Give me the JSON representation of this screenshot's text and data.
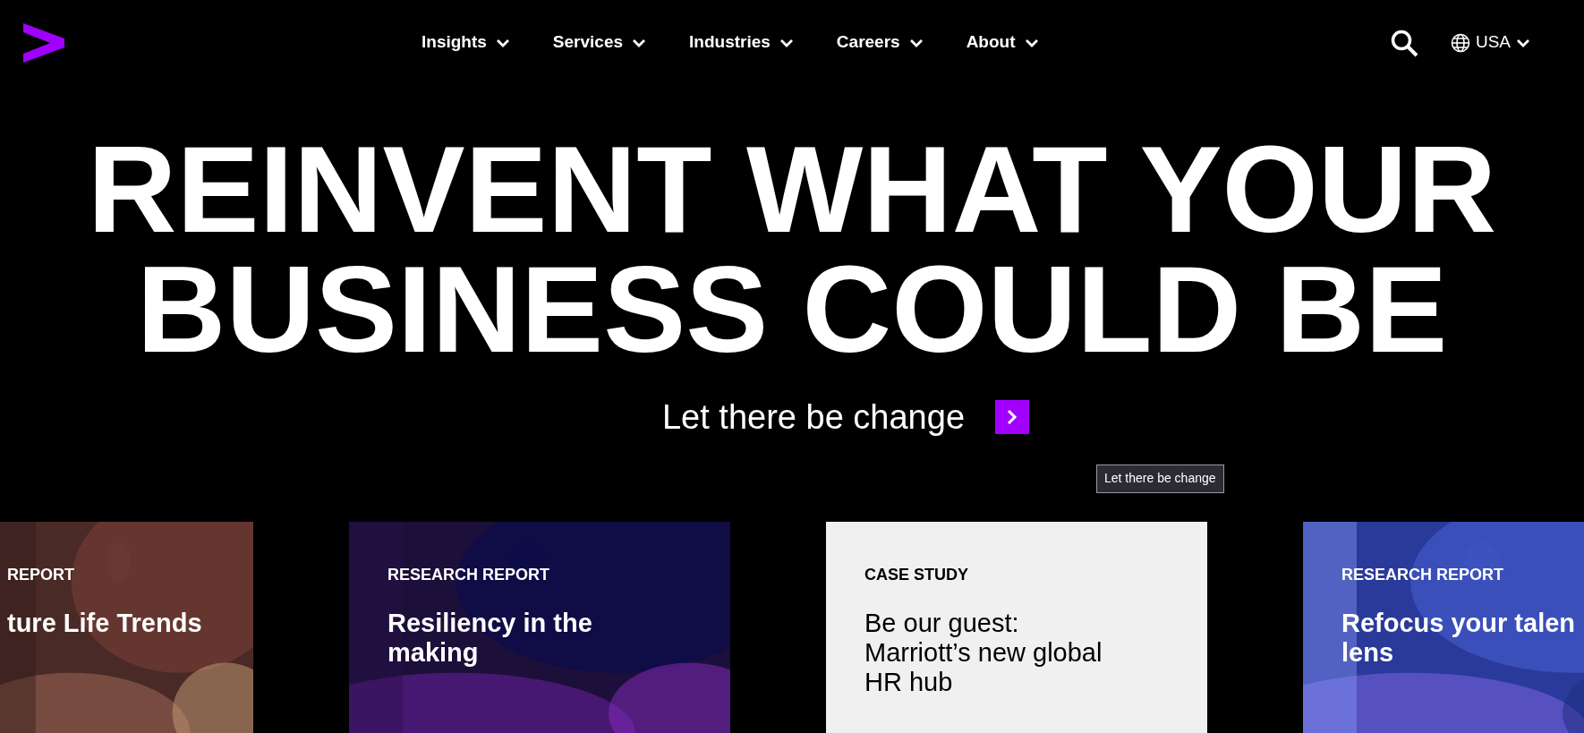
{
  "nav": {
    "items": [
      {
        "label": "Insights"
      },
      {
        "label": "Services"
      },
      {
        "label": "Industries"
      },
      {
        "label": "Careers"
      },
      {
        "label": "About"
      }
    ],
    "region": "USA"
  },
  "hero": {
    "lines": [
      "REINVENT WHAT YOUR",
      "BUSINESS COULD BE"
    ],
    "cta": "Let there be change",
    "tooltip": "Let there be change"
  },
  "cards": [
    {
      "label": "REPORT",
      "title": "ture Life Trends",
      "kind": "picture"
    },
    {
      "label": "RESEARCH REPORT",
      "title": "Resiliency in the\nmaking",
      "kind": "picture"
    },
    {
      "label": "CASE STUDY",
      "title": "Be our guest:\nMarriott’s new global\nHR hub",
      "kind": "plain"
    },
    {
      "label": "RESEARCH REPORT",
      "title": "Refocus your talen\nlens",
      "kind": "picture"
    }
  ]
}
